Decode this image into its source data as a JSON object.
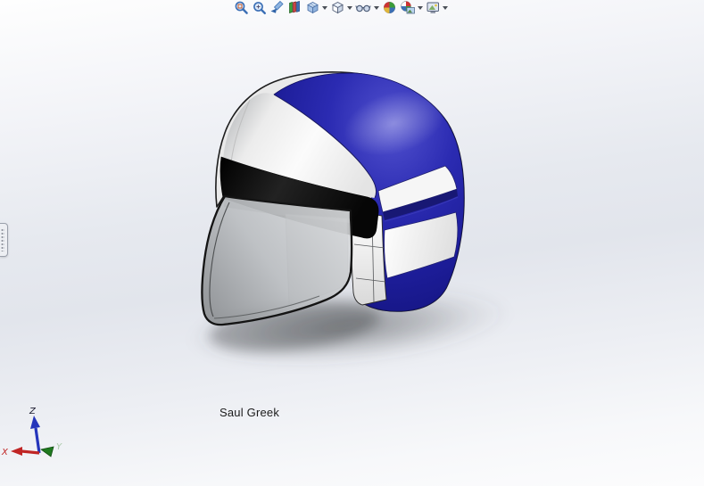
{
  "heads_up_toolbar": {
    "items": [
      {
        "icon": "zoom-to-fit-icon",
        "has_dropdown": false
      },
      {
        "icon": "zoom-to-area-icon",
        "has_dropdown": false
      },
      {
        "icon": "previous-view-icon",
        "has_dropdown": false
      },
      {
        "icon": "section-view-icon",
        "has_dropdown": false
      },
      {
        "icon": "view-orientation-icon",
        "has_dropdown": true
      },
      {
        "icon": "display-style-icon",
        "has_dropdown": true
      },
      {
        "icon": "hide-show-items-icon",
        "has_dropdown": true
      },
      {
        "icon": "edit-appearance-icon",
        "has_dropdown": false
      },
      {
        "icon": "apply-scene-icon",
        "has_dropdown": true
      },
      {
        "icon": "view-settings-icon",
        "has_dropdown": true
      }
    ]
  },
  "viewport": {
    "annotation_text": "Saul Greek",
    "model": {
      "name": "helmet",
      "colors": {
        "shell_blue": "#2626ab",
        "panel_white": "#f5f5f5",
        "brow_band_black": "#111111",
        "visor_gray": "#b6b9bc",
        "shadow_gray": "#55585c"
      }
    },
    "triad": {
      "z_label": "Z",
      "x_label": "X",
      "y_label": "Y",
      "z_color": "#2535bb",
      "x_color": "#c02525",
      "y_color": "#1f7a1f"
    },
    "background": {
      "top": "#fefefe",
      "middle": "#e2e5ec",
      "bottom": "#fcfcfd"
    }
  }
}
